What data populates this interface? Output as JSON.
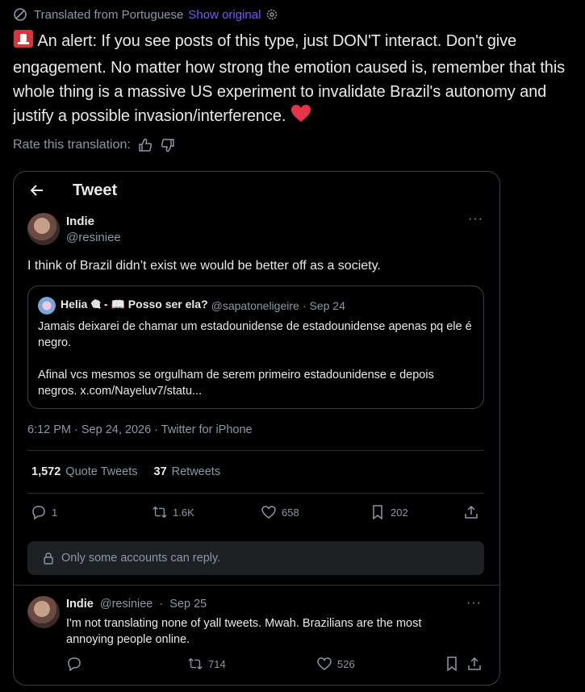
{
  "translation": {
    "label": "Translated from Portuguese",
    "show_original": "Show original"
  },
  "post": {
    "text": "An alert: If you see posts of this type, just DON'T interact. Don't give engagement. No matter how strong the emotion caused is, remember that this whole thing is a massive US experiment to invalidate Brazil's autonomy and justify a possible invasion/interference."
  },
  "rate": {
    "label": "Rate this translation:"
  },
  "card": {
    "title": "Tweet",
    "author": {
      "name": "Indie",
      "handle": "@resiniee"
    },
    "more": "···",
    "body": "I think of Brazil didn’t exist we would be better off as a society.",
    "quote": {
      "name": "Helia 🎕 - 📖 Posso ser ela?",
      "handle": "@sapatoneligeire",
      "sep": "·",
      "date": "Sep 24",
      "para1": "Jamais deixarei de chamar um estadounidense de estadounidense apenas pq ele é negro.",
      "para2": "Afinal vcs mesmos se orgulham de serem primeiro estadounidense e depois negros. x.com/Nayeluv7/statu..."
    },
    "timestamp": "6:12 PM · Sep 24, 2026 · Twitter for iPhone",
    "stats": {
      "quotes_count": "1,572",
      "quotes_label": "Quote Tweets",
      "retweets_count": "37",
      "retweets_label": "Retweets"
    },
    "actions": {
      "replies": "1",
      "retweets": "1.6K",
      "likes": "658",
      "bookmarks": "202"
    },
    "reply_restriction": "Only some accounts can reply.",
    "reply": {
      "name": "Indie",
      "handle": "@resiniee",
      "sep": "·",
      "date": "Sep 25",
      "more": "···",
      "text": "I'm not translating none of yall tweets. Mwah. Brazilians are the most annoying people online.",
      "actions": {
        "retweets": "714",
        "likes": "526"
      }
    }
  },
  "colors": {
    "accent": "#7856ff",
    "muted": "#8b98a5",
    "text": "#e7e9ea",
    "border": "#3b3f44"
  },
  "icons": [
    "globe-icon",
    "gear-icon",
    "siren-emoji",
    "heart-emoji",
    "thumbs-up-icon",
    "thumbs-down-icon",
    "back-arrow-icon",
    "reply-icon",
    "retweet-icon",
    "like-icon",
    "bookmark-icon",
    "share-icon",
    "lock-icon"
  ]
}
